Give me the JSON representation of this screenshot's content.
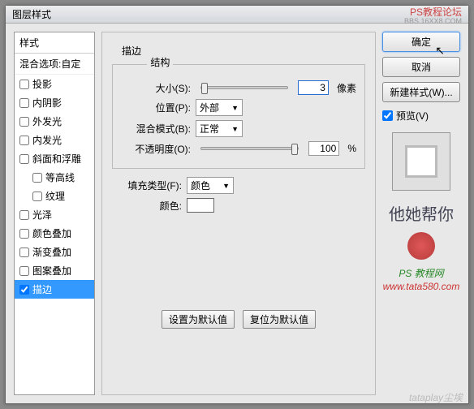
{
  "title": "图层样式",
  "watermark_top_line1": "PS教程论坛",
  "watermark_top_line2": "BBS.16XX8.COM",
  "styles_header": "样式",
  "blend_options": "混合选项:自定",
  "style_items": [
    {
      "label": "投影",
      "checked": false,
      "indent": false
    },
    {
      "label": "内阴影",
      "checked": false,
      "indent": false
    },
    {
      "label": "外发光",
      "checked": false,
      "indent": false
    },
    {
      "label": "内发光",
      "checked": false,
      "indent": false
    },
    {
      "label": "斜面和浮雕",
      "checked": false,
      "indent": false
    },
    {
      "label": "等高线",
      "checked": false,
      "indent": true
    },
    {
      "label": "纹理",
      "checked": false,
      "indent": true
    },
    {
      "label": "光泽",
      "checked": false,
      "indent": false
    },
    {
      "label": "颜色叠加",
      "checked": false,
      "indent": false
    },
    {
      "label": "渐变叠加",
      "checked": false,
      "indent": false
    },
    {
      "label": "图案叠加",
      "checked": false,
      "indent": false
    },
    {
      "label": "描边",
      "checked": true,
      "indent": false,
      "selected": true
    }
  ],
  "panel_title": "描边",
  "group_struct": "结构",
  "size_label": "大小(S):",
  "size_value": "3",
  "size_unit": "像素",
  "position_label": "位置(P):",
  "position_value": "外部",
  "blendmode_label": "混合模式(B):",
  "blendmode_value": "正常",
  "opacity_label": "不透明度(O):",
  "opacity_value": "100",
  "opacity_unit": "%",
  "filltype_label": "填充类型(F):",
  "filltype_value": "颜色",
  "color_label": "颜色:",
  "btn_default": "设置为默认值",
  "btn_reset": "复位为默认值",
  "btn_ok": "确定",
  "btn_cancel": "取消",
  "btn_newstyle": "新建样式(W)...",
  "preview_label": "预览(V)",
  "watermark_calli": "他她帮你",
  "watermark_foot1": "PS 教程网",
  "watermark_foot2": "www.tata580.com",
  "watermark_bottom": "tataplay尘埃"
}
